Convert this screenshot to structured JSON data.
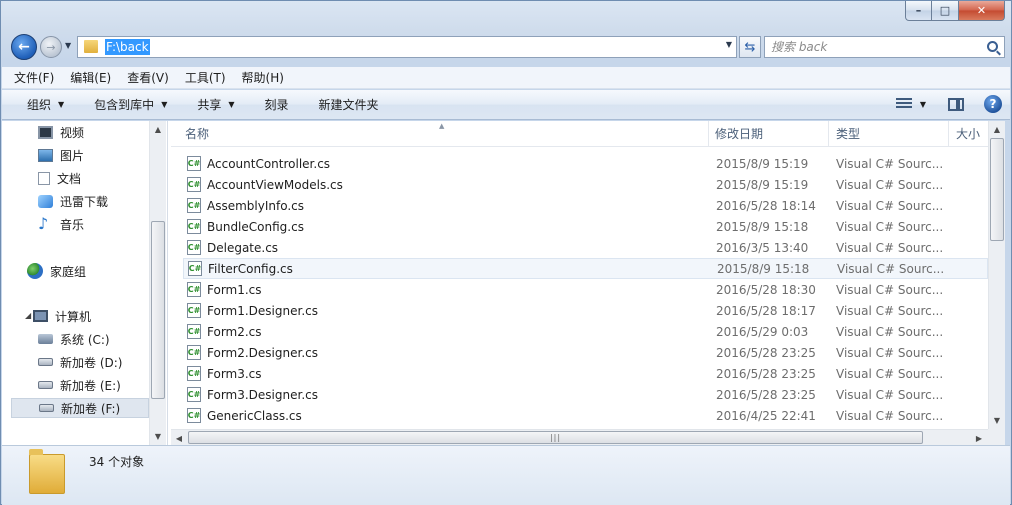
{
  "address": {
    "path": "F:\\back"
  },
  "search": {
    "placeholder": "搜索 back"
  },
  "menu": [
    "文件(F)",
    "编辑(E)",
    "查看(V)",
    "工具(T)",
    "帮助(H)"
  ],
  "toolbar": {
    "organize": "组织",
    "include_in_library": "包含到库中",
    "share": "共享",
    "burn": "刻录",
    "new_folder": "新建文件夹"
  },
  "nav": {
    "items": [
      {
        "label": "视频",
        "icon": "video-icon"
      },
      {
        "label": "图片",
        "icon": "picture-icon"
      },
      {
        "label": "文档",
        "icon": "document-icon"
      },
      {
        "label": "迅雷下载",
        "icon": "thunder-download-icon"
      },
      {
        "label": "音乐",
        "icon": "music-icon"
      },
      {
        "label": "家庭组",
        "icon": "homegroup-icon"
      },
      {
        "label": "计算机",
        "icon": "computer-icon"
      },
      {
        "label": "系统 (C:)",
        "icon": "system-drive-icon"
      },
      {
        "label": "新加卷 (D:)",
        "icon": "drive-icon"
      },
      {
        "label": "新加卷 (E:)",
        "icon": "drive-icon"
      },
      {
        "label": "新加卷 (F:)",
        "icon": "drive-icon",
        "selected": true
      }
    ]
  },
  "columns": {
    "name": "名称",
    "modified": "修改日期",
    "type": "类型",
    "size": "大小"
  },
  "files": [
    {
      "name": "AccountController.cs",
      "date": "2015/8/9 15:19",
      "type": "Visual C# Sourc..."
    },
    {
      "name": "AccountViewModels.cs",
      "date": "2015/8/9 15:19",
      "type": "Visual C# Sourc..."
    },
    {
      "name": "AssemblyInfo.cs",
      "date": "2016/5/28 18:14",
      "type": "Visual C# Sourc..."
    },
    {
      "name": "BundleConfig.cs",
      "date": "2015/8/9 15:18",
      "type": "Visual C# Sourc..."
    },
    {
      "name": "Delegate.cs",
      "date": "2016/3/5 13:40",
      "type": "Visual C# Sourc..."
    },
    {
      "name": "FilterConfig.cs",
      "date": "2015/8/9 15:18",
      "type": "Visual C# Sourc...",
      "hover": true
    },
    {
      "name": "Form1.cs",
      "date": "2016/5/28 18:30",
      "type": "Visual C# Sourc..."
    },
    {
      "name": "Form1.Designer.cs",
      "date": "2016/5/28 18:17",
      "type": "Visual C# Sourc..."
    },
    {
      "name": "Form2.cs",
      "date": "2016/5/29 0:03",
      "type": "Visual C# Sourc..."
    },
    {
      "name": "Form2.Designer.cs",
      "date": "2016/5/28 23:25",
      "type": "Visual C# Sourc..."
    },
    {
      "name": "Form3.cs",
      "date": "2016/5/28 23:25",
      "type": "Visual C# Sourc..."
    },
    {
      "name": "Form3.Designer.cs",
      "date": "2016/5/28 23:25",
      "type": "Visual C# Sourc..."
    },
    {
      "name": "GenericClass.cs",
      "date": "2016/4/25 22:41",
      "type": "Visual C# Sourc..."
    }
  ],
  "status": {
    "count": "34 个对象"
  }
}
